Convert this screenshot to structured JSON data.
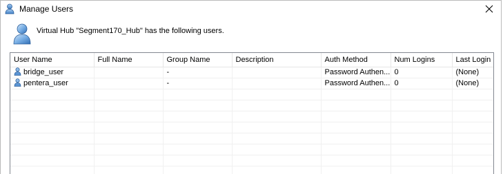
{
  "window": {
    "title": "Manage Users"
  },
  "header": {
    "message": "Virtual Hub \"Segment170_Hub\" has the following users."
  },
  "table": {
    "columns": [
      "User Name",
      "Full Name",
      "Group Name",
      "Description",
      "Auth Method",
      "Num Logins",
      "Last Login"
    ],
    "rows": [
      {
        "user_name": "bridge_user",
        "full_name": "",
        "group_name": "-",
        "description": "",
        "auth_method": "Password Authen...",
        "num_logins": "0",
        "last_login": "(None)"
      },
      {
        "user_name": "pentera_user",
        "full_name": "",
        "group_name": "-",
        "description": "",
        "auth_method": "Password Authen...",
        "num_logins": "0",
        "last_login": "(None)"
      }
    ]
  },
  "icons": {
    "title": "user-icon",
    "header": "user-icon",
    "row": "user-icon",
    "close": "close-icon"
  },
  "colors": {
    "accent_blue": "#3f7fc6",
    "border": "#828790",
    "grid": "#f0f0f0"
  }
}
